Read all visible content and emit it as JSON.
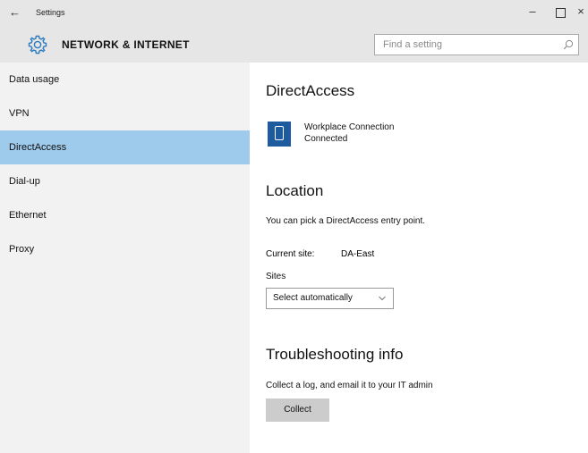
{
  "window": {
    "back_glyph": "←",
    "title": "Settings",
    "minimize_glyph": "–",
    "close_glyph": "×"
  },
  "header": {
    "section_title": "NETWORK & INTERNET",
    "search_placeholder": "Find a setting",
    "gear_icon": "gear-icon",
    "search_icon": "search-icon"
  },
  "sidebar": {
    "items": [
      {
        "label": "Data usage",
        "active": false
      },
      {
        "label": "VPN",
        "active": false
      },
      {
        "label": "DirectAccess",
        "active": true
      },
      {
        "label": "Dial-up",
        "active": false
      },
      {
        "label": "Ethernet",
        "active": false
      },
      {
        "label": "Proxy",
        "active": false
      }
    ],
    "active_color": "#9ecaec"
  },
  "content": {
    "directaccess_heading": "DirectAccess",
    "connection_name": "Workplace Connection",
    "connection_status": "Connected",
    "location_heading": "Location",
    "location_description": "You can pick a DirectAccess entry point.",
    "current_site_label": "Current site:",
    "current_site_value": "DA-East",
    "sites_label": "Sites",
    "sites_selected": "Select automatically",
    "troubleshooting_heading": "Troubleshooting info",
    "troubleshooting_description": "Collect a log, and email it to your IT admin",
    "collect_label": "Collect",
    "device_icon_color": "#1e5a9e"
  }
}
